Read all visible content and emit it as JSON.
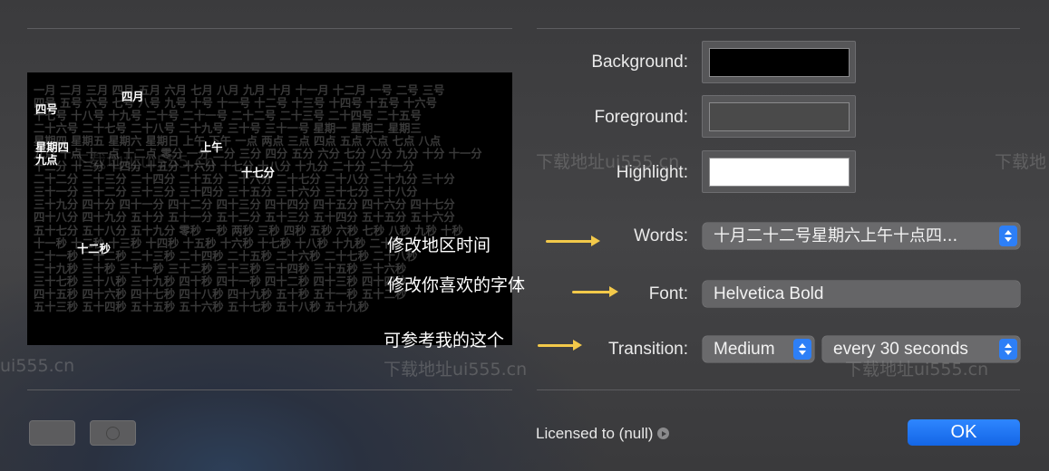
{
  "preview": {
    "grid_lines": [
      "一月 二月 三月 四月 五月 六月 七月 八月 九月 十月 十一月 十二月 一号 二号 三号",
      "四号 五号 六号 七号 八号 九号 十号 十一号 十二号 十三号 十四号 十五号 十六号",
      "十七号 十八号 十九号 二十号 二十一号 二十二号 二十三号 二十四号 二十五号",
      "二十六号 二十七号 二十八号 二十九号 三十号 三十一号 星期一 星期二 星期三",
      "星期四 星期五 星期六 星期日 上午 下午 一点 两点 三点 四点 五点 六点 七点 八点",
      "九点 十点 十一点 十二点 零分 一分 二分 三分 四分 五分 六分 七分 八分 九分 十分 十一分",
      "十二分 十三分 十四分 十五分 十六分 十七分 十八分 十九分 二十分 二十一分",
      "二十二分 二十三分 二十四分 二十五分 二十六分 二十七分 二十八分 二十九分 三十分",
      "三十一分 三十二分 三十三分 三十四分 三十五分 三十六分 三十七分 三十八分",
      "三十九分 四十分 四十一分 四十二分 四十三分 四十四分 四十五分 四十六分 四十七分",
      "四十八分 四十九分 五十分 五十一分 五十二分 五十三分 五十四分 五十五分 五十六分",
      "五十七分 五十八分 五十九分 零秒 一秒 两秒 三秒 四秒 五秒 六秒 七秒 八秒 九秒 十秒",
      "十一秒 十二秒 十三秒 十四秒 十五秒 十六秒 十七秒 十八秒 十九秒 二十秒",
      "二十一秒 二十二秒 二十三秒 二十四秒 二十五秒 二十六秒 二十七秒 二十八秒",
      "二十九秒 三十秒 三十一秒 三十二秒 三十三秒 三十四秒 三十五秒 三十六秒",
      "三十七秒 三十八秒 三十九秒 四十秒 四十一秒 四十二秒 四十三秒 四十四秒",
      "四十五秒 四十六秒 四十七秒 四十八秒 四十九秒 五十秒 五十一秒 五十二秒",
      "五十三秒 五十四秒 五十五秒 五十六秒 五十七秒 五十八秒 五十九秒"
    ],
    "highlights": {
      "month": "四月",
      "day": "四号",
      "weekday": "星期四",
      "ampm": "上午",
      "hour": "九点",
      "minute": "十七分",
      "second": "十二秒"
    }
  },
  "settings": {
    "background_label": "Background:",
    "foreground_label": "Foreground:",
    "highlight_label": "Highlight:",
    "words_label": "Words:",
    "words_value": "十月二十二号星期六上午十点四...",
    "font_label": "Font:",
    "font_value": "Helvetica Bold",
    "transition_label": "Transition:",
    "transition_speed": "Medium",
    "transition_interval": "every 30 seconds"
  },
  "colors": {
    "background": "#000000",
    "foreground": "#4a4a4a",
    "highlight": "#ffffff",
    "accent": "#2d7ff7",
    "annotation_arrow": "#f3c94a"
  },
  "annotations": {
    "words_note": "修改地区时间",
    "font_note": "修改你喜欢的字体",
    "transition_note": "可参考我的这个"
  },
  "watermarks": [
    "下载地址ui555.cn",
    "下载地",
    "ui555.cn",
    "下载地址ui555.cn",
    "下载地址ui555.cn",
    "下载地址ui555.cn"
  ],
  "footer": {
    "licensed": "Licensed to (null)",
    "ok_label": "OK"
  }
}
